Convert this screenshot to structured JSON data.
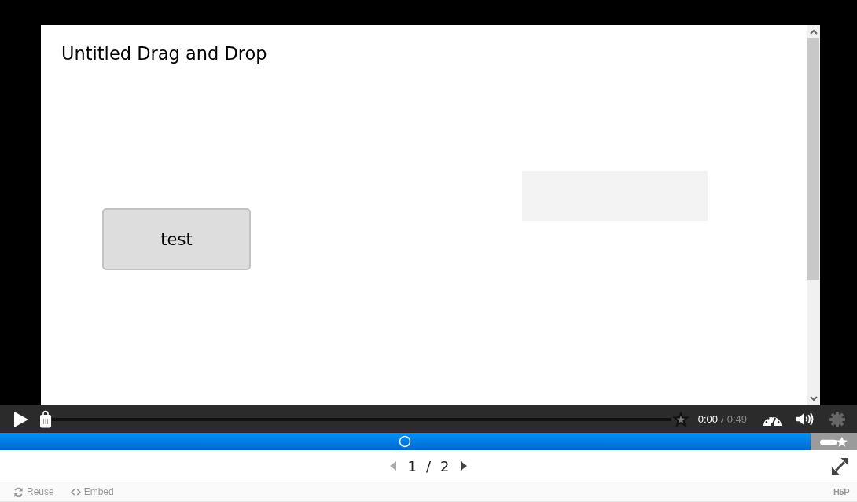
{
  "task": {
    "title": "Untitled Drag and Drop",
    "draggables": [
      {
        "text": "test"
      }
    ]
  },
  "player": {
    "playing": false,
    "seek": {
      "level": 0
    },
    "time": {
      "elapsed": "0:00",
      "separator": "/",
      "total": "0:49"
    }
  },
  "pager": {
    "current": "1",
    "separator": "/",
    "total": "2",
    "prev_disabled": true,
    "next_disabled": false
  },
  "footer": {
    "actions": [
      {
        "kind": "reuse",
        "label": "Reuse"
      },
      {
        "kind": "embed",
        "label": "Embed"
      }
    ],
    "logo": "H5P"
  }
}
